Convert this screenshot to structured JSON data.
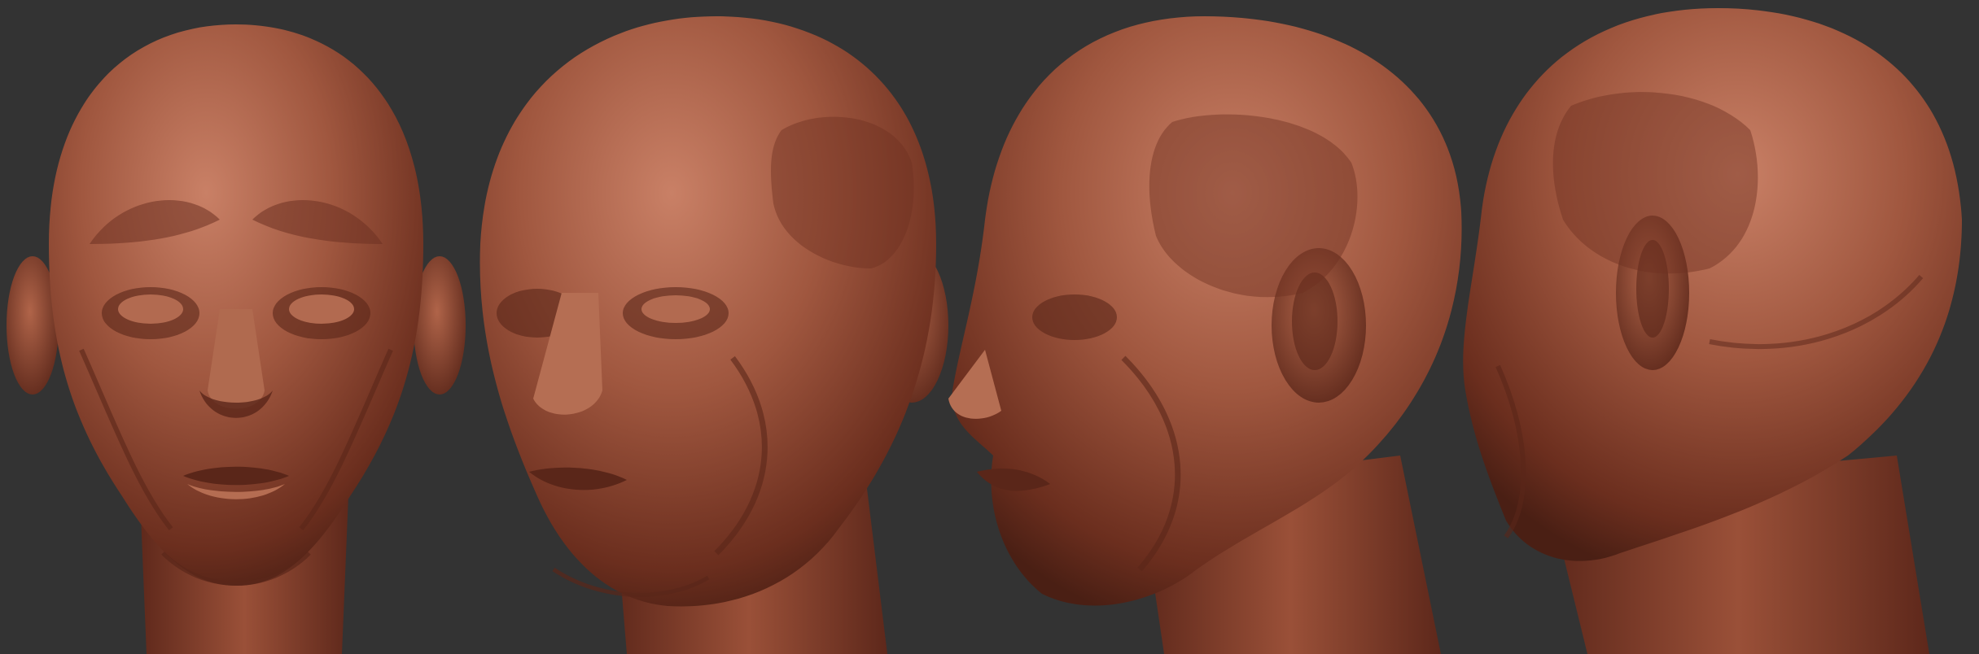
{
  "scene": {
    "description_free": true,
    "background": "#333333",
    "clay": {
      "base": "#8a4431",
      "light": "#c77d63",
      "mid": "#a25942",
      "dark": "#5a2619",
      "deep": "#3e1a11"
    },
    "views": [
      {
        "name": "front-view"
      },
      {
        "name": "three-quarter-view"
      },
      {
        "name": "side-view"
      },
      {
        "name": "back-three-quarter-view"
      }
    ]
  }
}
